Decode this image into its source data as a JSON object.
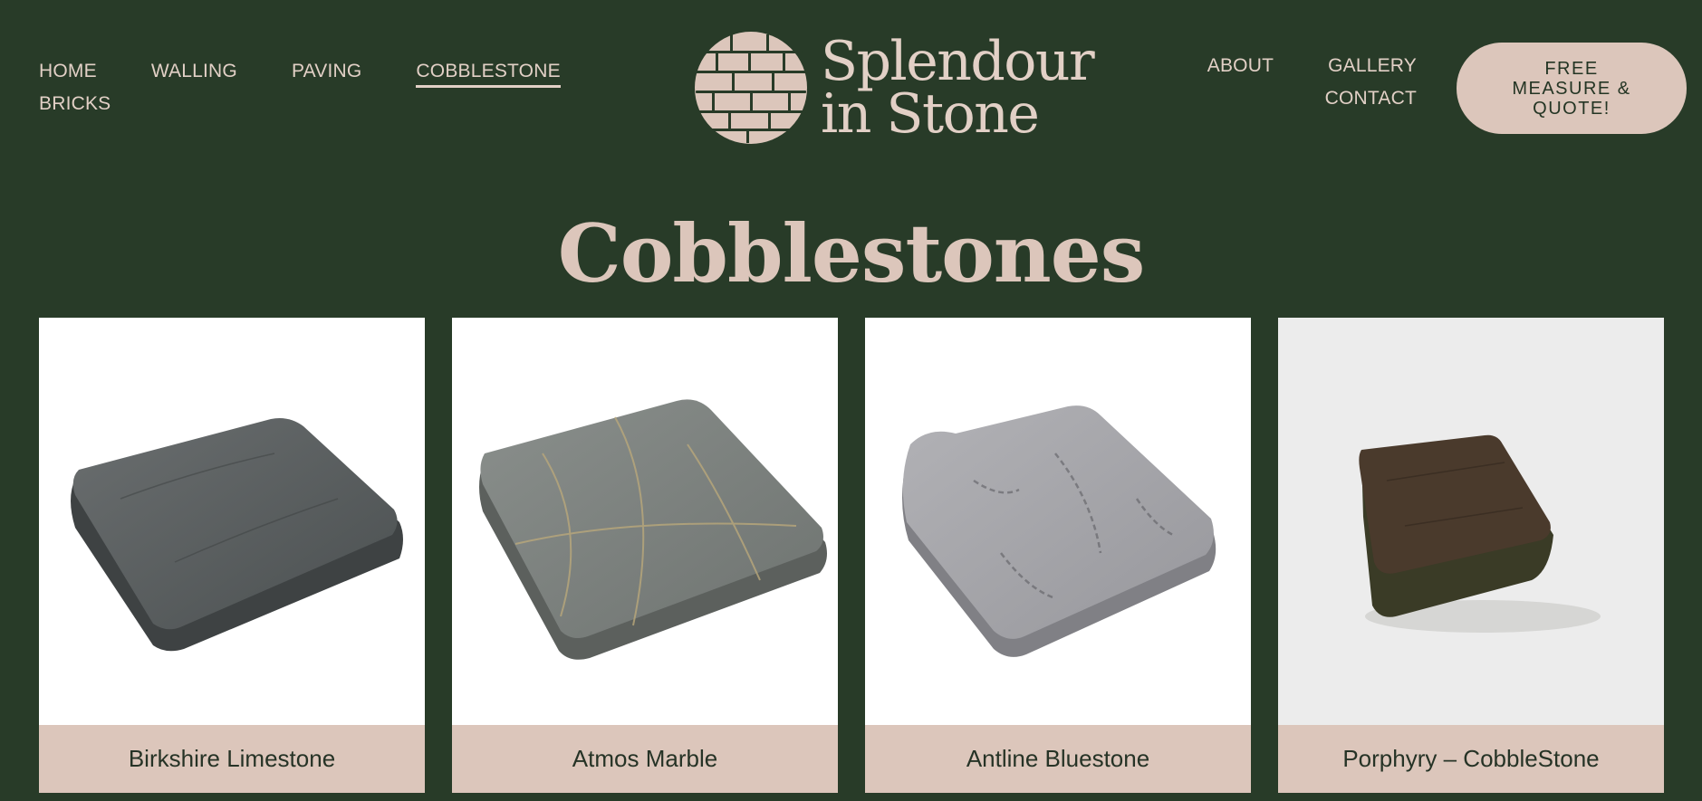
{
  "brand": {
    "name_line1": "Splendour",
    "name_line2": "in Stone",
    "colors": {
      "background": "#283b28",
      "accent": "#dcc6bb",
      "text_dark": "#263326"
    }
  },
  "nav_left": {
    "items": [
      {
        "label": "HOME",
        "active": false
      },
      {
        "label": "WALLING",
        "active": false
      },
      {
        "label": "PAVING",
        "active": false
      },
      {
        "label": "COBBLESTONE",
        "active": true
      },
      {
        "label": "BRICKS",
        "active": false
      }
    ]
  },
  "nav_right": {
    "items": [
      {
        "label": "ABOUT"
      },
      {
        "label": "GALLERY"
      },
      {
        "label": "CONTACT"
      }
    ]
  },
  "cta": {
    "label": "FREE MEASURE & QUOTE!"
  },
  "page": {
    "title": "Cobblestones"
  },
  "products": [
    {
      "name": "Birkshire Limestone",
      "image_icon": "dark-grey-stone-photo"
    },
    {
      "name": "Atmos Marble",
      "image_icon": "veined-marble-stone-photo"
    },
    {
      "name": "Antline Bluestone",
      "image_icon": "light-grey-stone-photo"
    },
    {
      "name": "Porphyry – CobbleStone",
      "image_icon": "brown-porphyry-stone-photo"
    }
  ]
}
